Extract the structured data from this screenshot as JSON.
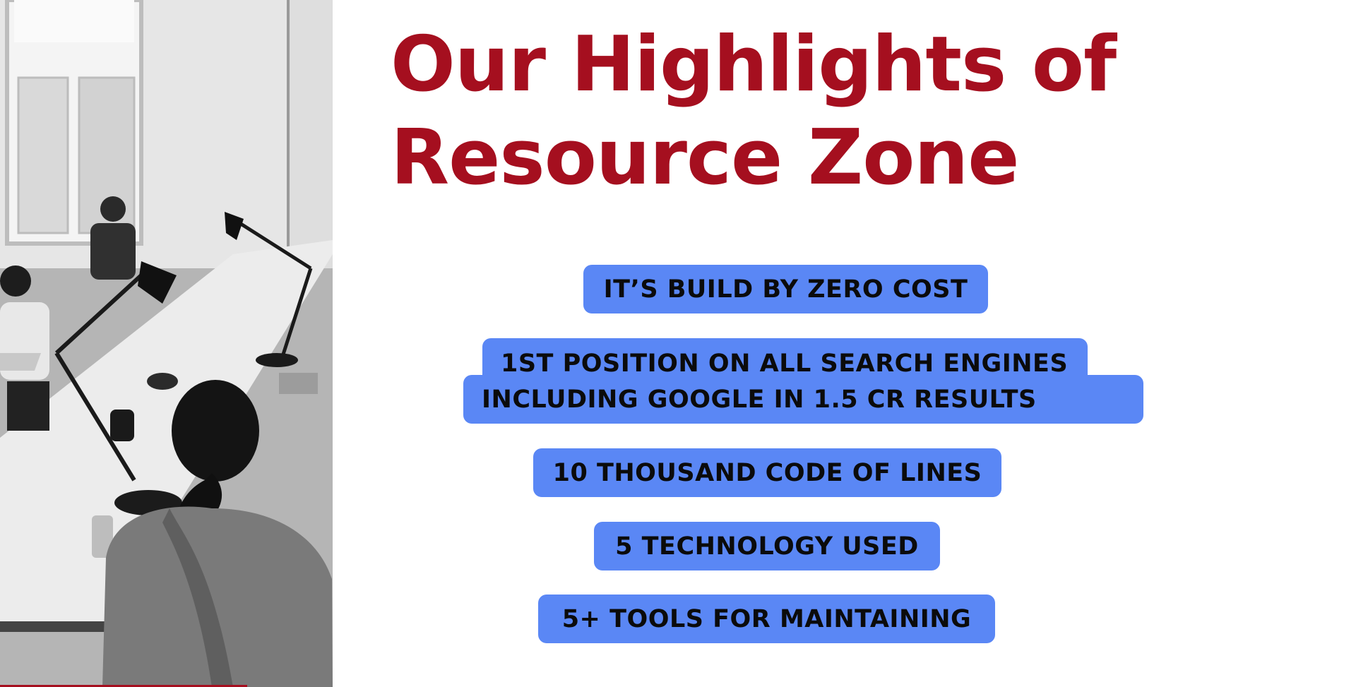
{
  "heading": {
    "line1": "Our Highlights of",
    "line2": "Resource Zone"
  },
  "highlights": [
    {
      "label": "IT’S BUILD BY ZERO COST"
    },
    {
      "line1": "1ST POSITION ON ALL SEARCH ENGINES",
      "line2": "INCLUDING  GOOGLE  IN 1.5 CR RESULTS"
    },
    {
      "label": "10 THOUSAND CODE OF LINES"
    },
    {
      "label": "5 TECHNOLOGY USED"
    },
    {
      "label": "5+ TOOLS FOR MAINTAINING"
    }
  ],
  "colors": {
    "heading": "#a50f1f",
    "pill_background": "#5a87f5",
    "pill_text": "#0b0b0b",
    "background": "#ffffff"
  },
  "photo": {
    "style": "black-and-white office meeting photo"
  }
}
